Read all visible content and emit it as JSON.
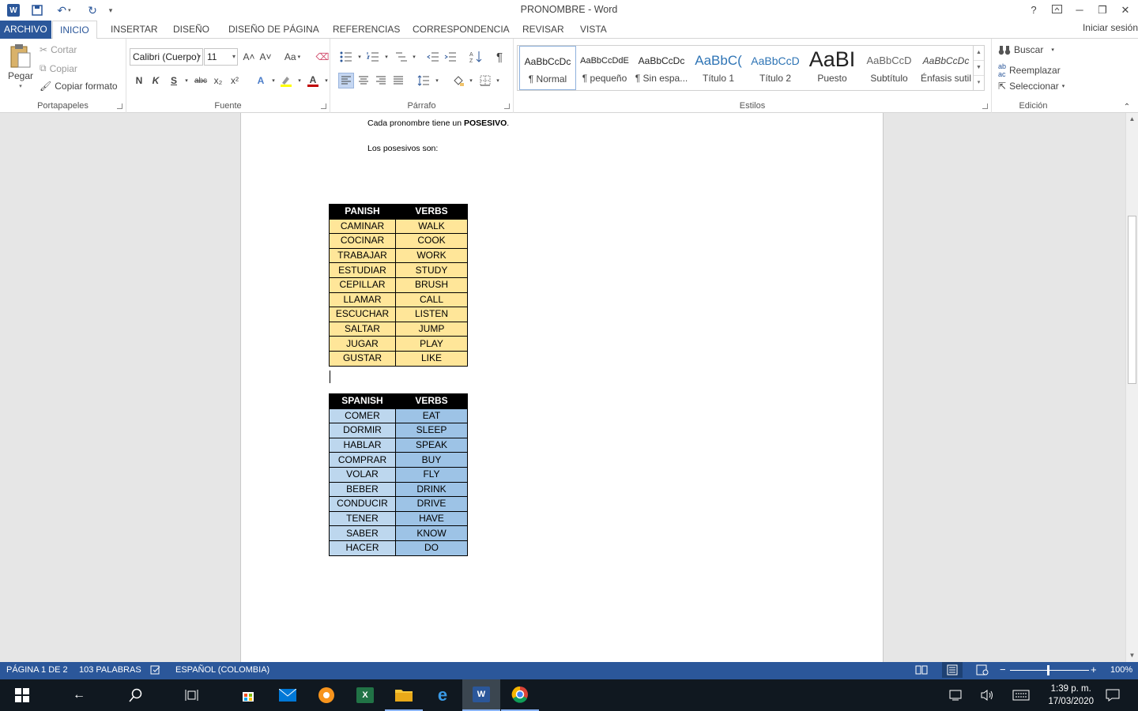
{
  "window": {
    "title": "PRONOMBRE - Word",
    "help_label": "?",
    "minimize_label": "─",
    "restore_label": "❐",
    "close_label": "✕"
  },
  "tabs": {
    "file": "ARCHIVO",
    "items": [
      "INICIO",
      "INSERTAR",
      "DISEÑO",
      "DISEÑO DE PÁGINA",
      "REFERENCIAS",
      "CORRESPONDENCIA",
      "REVISAR",
      "VISTA"
    ],
    "signin": "Iniciar sesión"
  },
  "clipboard": {
    "paste": "Pegar",
    "cut": "Cortar",
    "copy": "Copiar",
    "format_painter": "Copiar formato",
    "group_label": "Portapapeles"
  },
  "font": {
    "name": "Calibri (Cuerpo)",
    "size": "11",
    "grow": "A˄",
    "shrink": "A˅",
    "case": "Aa",
    "bold": "N",
    "italic": "K",
    "underline": "S",
    "strike": "abc",
    "subscript": "x₂",
    "superscript": "x²",
    "color_letter": "A",
    "group_label": "Fuente"
  },
  "paragraph": {
    "group_label": "Párrafo",
    "pilcrow": "¶"
  },
  "styles": {
    "group_label": "Estilos",
    "items": [
      {
        "preview": "AaBbCcDc",
        "name": "¶ Normal"
      },
      {
        "preview": "AaBbCcDdE",
        "name": "¶ pequeño"
      },
      {
        "preview": "AaBbCcDc",
        "name": "¶ Sin espa..."
      },
      {
        "preview": "AaBbC(",
        "name": "Título 1"
      },
      {
        "preview": "AaBbCcD",
        "name": "Título 2"
      },
      {
        "preview": "AaBI",
        "name": "Puesto"
      },
      {
        "preview": "AaBbCcD",
        "name": "Subtítulo"
      },
      {
        "preview": "AaBbCcDc",
        "name": "Énfasis sutil"
      }
    ]
  },
  "editing": {
    "find": "Buscar",
    "replace": "Reemplazar",
    "select": "Seleccionar",
    "group_label": "Edición"
  },
  "document": {
    "line1_prefix": "Cada pronombre tiene un ",
    "line1_bold": "POSESIVO",
    "line1_suffix": ".",
    "line2": "Los posesivos son:",
    "table1": {
      "headers": [
        "PANISH",
        "VERBS"
      ],
      "rows": [
        [
          "CAMINAR",
          "WALK"
        ],
        [
          "COCINAR",
          "COOK"
        ],
        [
          "TRABAJAR",
          "WORK"
        ],
        [
          "ESTUDIAR",
          "STUDY"
        ],
        [
          "CEPILLAR",
          "BRUSH"
        ],
        [
          "LLAMAR",
          "CALL"
        ],
        [
          "ESCUCHAR",
          "LISTEN"
        ],
        [
          "SALTAR",
          "JUMP"
        ],
        [
          "JUGAR",
          "PLAY"
        ],
        [
          "GUSTAR",
          "LIKE"
        ]
      ]
    },
    "table2": {
      "headers": [
        "SPANISH",
        "VERBS"
      ],
      "rows": [
        [
          "COMER",
          "EAT"
        ],
        [
          "DORMIR",
          "SLEEP"
        ],
        [
          "HABLAR",
          "SPEAK"
        ],
        [
          "COMPRAR",
          "BUY"
        ],
        [
          "VOLAR",
          "FLY"
        ],
        [
          "BEBER",
          "DRINK"
        ],
        [
          "CONDUCIR",
          "DRIVE"
        ],
        [
          "TENER",
          "HAVE"
        ],
        [
          "SABER",
          "KNOW"
        ],
        [
          "HACER",
          "DO"
        ]
      ]
    }
  },
  "status": {
    "page": "PÁGINA 1 DE 2",
    "words": "103 PALABRAS",
    "language": "ESPAÑOL (COLOMBIA)",
    "zoom": "100%",
    "zoom_minus": "−",
    "zoom_plus": "+"
  },
  "taskbar": {
    "time": "1:39 p. m.",
    "date": "17/03/2020"
  },
  "colors": {
    "word_blue": "#2b579a",
    "table1_fill": "#ffe699",
    "table2_fill": "#9dc3e6",
    "taskbar": "#101820"
  }
}
